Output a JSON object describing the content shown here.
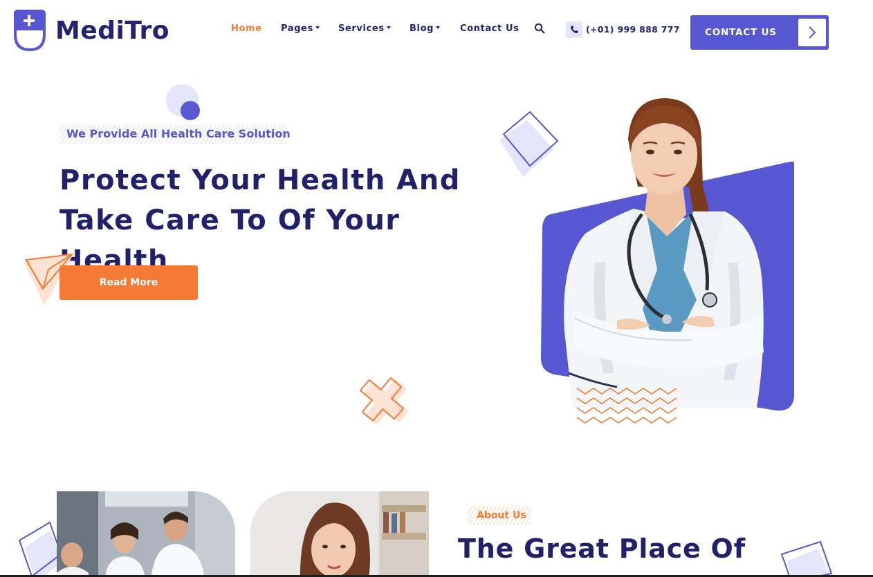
{
  "brand": {
    "name": "MediTro",
    "primary_color": "#5757d2",
    "accent_color": "#f47b36",
    "dark_color": "#20206b",
    "logo_icon": "medical-plus-shield-icon"
  },
  "nav": {
    "items": [
      {
        "label": "Home",
        "active": true,
        "dropdown": false
      },
      {
        "label": "Pages",
        "active": false,
        "dropdown": true
      },
      {
        "label": "Services",
        "active": false,
        "dropdown": true
      },
      {
        "label": "Blog",
        "active": false,
        "dropdown": true
      },
      {
        "label": "Contact Us",
        "active": false,
        "dropdown": false
      }
    ],
    "search_icon": "search-icon",
    "phone_icon": "phone-icon",
    "phone": "(+01) 999 888 777",
    "cta_label": "CONTACT US",
    "cta_icon": "chevron-right-icon"
  },
  "hero": {
    "tagline": "We Provide All Health Care Solution",
    "title_line1": "Protect Your Health And",
    "title_line2": "Take Care To Of Your Health",
    "button_label": "Read More"
  },
  "about": {
    "tag": "About Us",
    "title": "The Great Place Of"
  }
}
